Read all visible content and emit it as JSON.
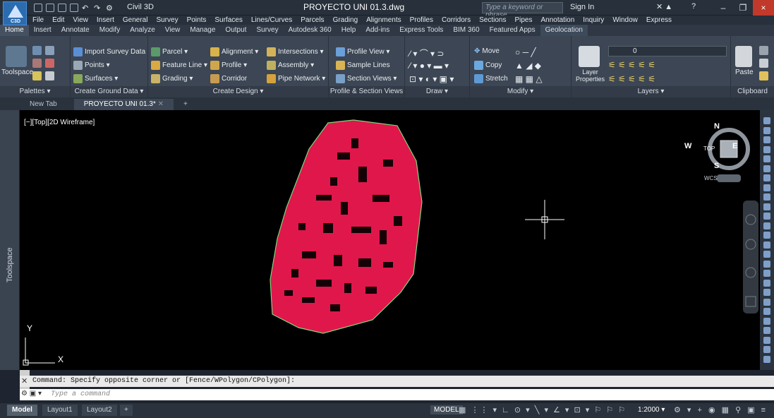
{
  "titlebar": {
    "app_badge": "C3D",
    "workspace": "Civil 3D",
    "document_title": "PROYECTO UNI 01.3.dwg",
    "search_placeholder": "Type a keyword or phrase",
    "signin": "Sign In",
    "help": "?",
    "close": "×"
  },
  "menubar": [
    "File",
    "Edit",
    "View",
    "Insert",
    "General",
    "Survey",
    "Points",
    "Surfaces",
    "Lines/Curves",
    "Parcels",
    "Grading",
    "Alignments",
    "Profiles",
    "Corridors",
    "Sections",
    "Pipes",
    "Annotation",
    "Inquiry",
    "Window",
    "Express"
  ],
  "ribbon_tabs": [
    "Home",
    "Insert",
    "Annotate",
    "Modify",
    "Analyze",
    "View",
    "Manage",
    "Output",
    "Survey",
    "Autodesk 360",
    "Help",
    "Add-ins",
    "Express Tools",
    "BIM 360",
    "Featured Apps",
    "Geolocation"
  ],
  "ribbon": {
    "palettes": {
      "toolspace": "Toolspace",
      "title": "Palettes ▾"
    },
    "ground": {
      "import": "Import Survey Data",
      "points": "Points ▾",
      "surfaces": "Surfaces ▾",
      "title": "Create Ground Data ▾"
    },
    "design": {
      "parcel": "Parcel ▾",
      "feature_line": "Feature Line ▾",
      "grading": "Grading ▾",
      "alignment": "Alignment ▾",
      "profile": "Profile ▾",
      "corridor": "Corridor",
      "intersections": "Intersections ▾",
      "assembly": "Assembly ▾",
      "pipe_network": "Pipe Network ▾",
      "title": "Create Design ▾"
    },
    "profile_section": {
      "profile_view": "Profile View ▾",
      "sample_lines": "Sample Lines",
      "section_views": "Section Views ▾",
      "title": "Profile & Section Views"
    },
    "draw": {
      "title": "Draw ▾"
    },
    "modify": {
      "move": "Move",
      "copy": "Copy",
      "stretch": "Stretch",
      "title": "Modify ▾"
    },
    "layers": {
      "layer_properties": "Layer Properties",
      "current_layer": "0",
      "title": "Layers ▾"
    },
    "clipboard": {
      "paste": "Paste",
      "title": "Clipboard"
    }
  },
  "file_tabs": [
    "New Tab",
    "PROYECTO UNI 01.3*"
  ],
  "viewport_label": "[−][Top][2D Wireframe]",
  "toolspace_label": "Toolspace",
  "viewcube": {
    "n": "N",
    "s": "S",
    "e": "E",
    "w": "W",
    "top": "TOP",
    "wcs": "WCS"
  },
  "ucs": {
    "x": "X",
    "y": "Y"
  },
  "command": {
    "history": "Command: Specify opposite corner or [Fence/WPolygon/CPolygon]:",
    "input_placeholder": "Type a command"
  },
  "layout_tabs": [
    "Model",
    "Layout1",
    "Layout2"
  ],
  "status": {
    "model": "MODEL",
    "scale": "1:2000 ▾"
  },
  "colors": {
    "accent": "#2b6cb0",
    "site_fill": "#e0174a",
    "background": "#000000"
  }
}
